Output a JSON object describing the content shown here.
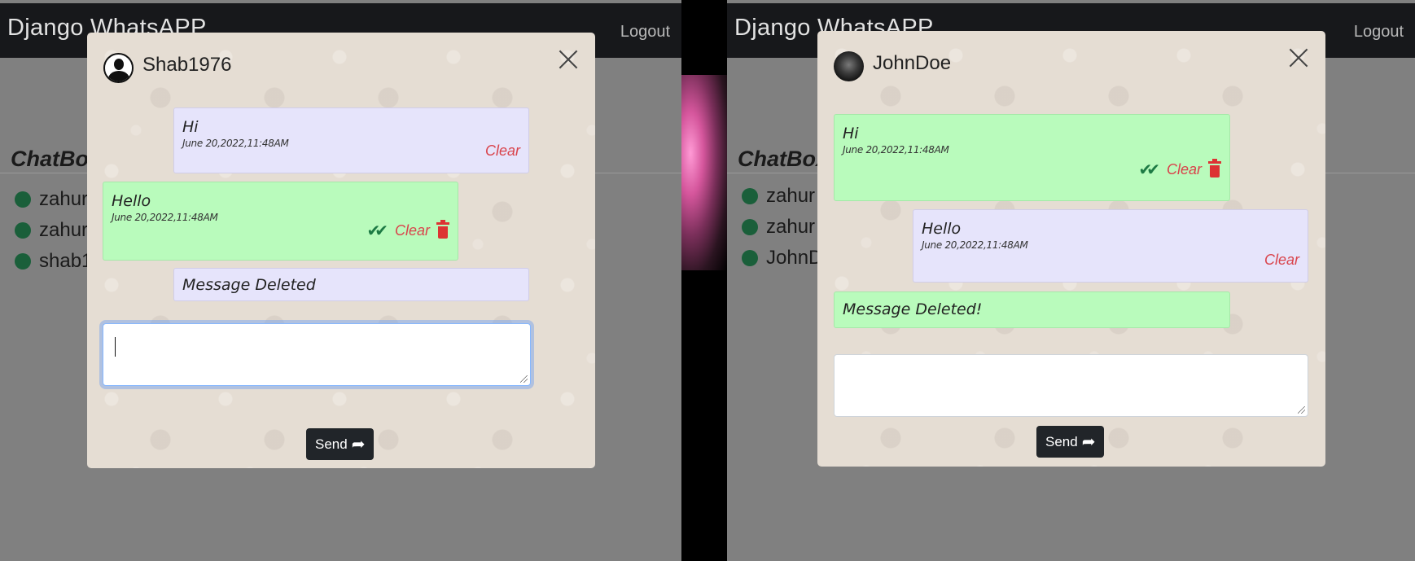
{
  "left": {
    "brand": "Django WhatsAPP",
    "logout": "Logout",
    "chatbox_title": "ChatBox",
    "users": [
      "zahur",
      "zahur",
      "shab1"
    ],
    "modal": {
      "title": "Shab1976",
      "messages": [
        {
          "text": "Hi",
          "time": "June 20,2022,11:48AM",
          "clear": "Clear"
        },
        {
          "text": "Hello",
          "time": "June 20,2022,11:48AM",
          "clear": "Clear"
        },
        {
          "text": "Message Deleted"
        }
      ],
      "send_label": "Send"
    }
  },
  "right": {
    "brand": "Django WhatsAPP",
    "logout": "Logout",
    "chatbox_title": "ChatBox",
    "users": [
      "zahur",
      "zahur",
      "JohnD"
    ],
    "modal": {
      "title": "JohnDoe",
      "messages": [
        {
          "text": "Hi",
          "time": "June 20,2022,11:48AM",
          "clear": "Clear"
        },
        {
          "text": "Hello",
          "time": "June 20,2022,11:48AM",
          "clear": "Clear"
        },
        {
          "text": "Message Deleted!"
        }
      ],
      "send_label": "Send"
    }
  },
  "colors": {
    "navbar": "#17181b",
    "sent_bubble": "#b9fbbc",
    "received_bubble": "#e6e4fb",
    "clear_text": "#d9434b",
    "read_check": "#1d7a44",
    "online_dot": "#1a5f3a",
    "send_button": "#212529"
  },
  "icons": {
    "read_receipt": "double-check-icon",
    "delete": "trash-icon",
    "close": "close-icon",
    "send": "share-arrow-icon"
  }
}
